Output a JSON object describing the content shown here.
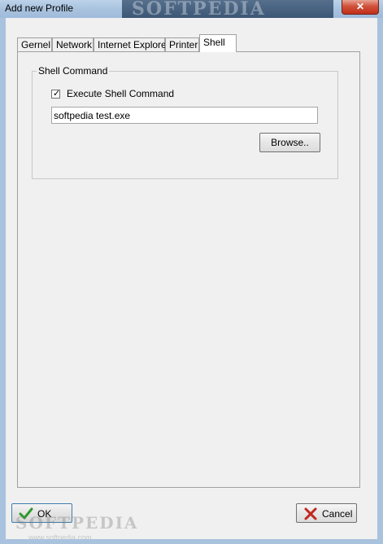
{
  "window": {
    "title": "Add new Profile",
    "close_label": "✕",
    "watermark_top": "SOFTPEDIA",
    "watermark_bottom": "SOFTPEDIA",
    "watermark_bottom_sub": "www.softpedia.com"
  },
  "tabs": [
    {
      "label": "Gernel",
      "active": false
    },
    {
      "label": "Network",
      "active": false
    },
    {
      "label": "Internet Explorer",
      "active": false
    },
    {
      "label": "Printer",
      "active": false
    },
    {
      "label": "Shell",
      "active": true
    }
  ],
  "shell": {
    "group_label": "Shell Command",
    "execute_label": "Execute Shell Command",
    "execute_checked": true,
    "command_value": "softpedia test.exe",
    "browse_label": "Browse.."
  },
  "footer": {
    "ok_label": "OK",
    "cancel_label": "Cancel",
    "ok_icon": "check-icon",
    "cancel_icon": "x-icon"
  },
  "colors": {
    "ok_check": "#2f9a2f",
    "cancel_x": "#c0281f",
    "title_bar": "#a9c3de"
  }
}
